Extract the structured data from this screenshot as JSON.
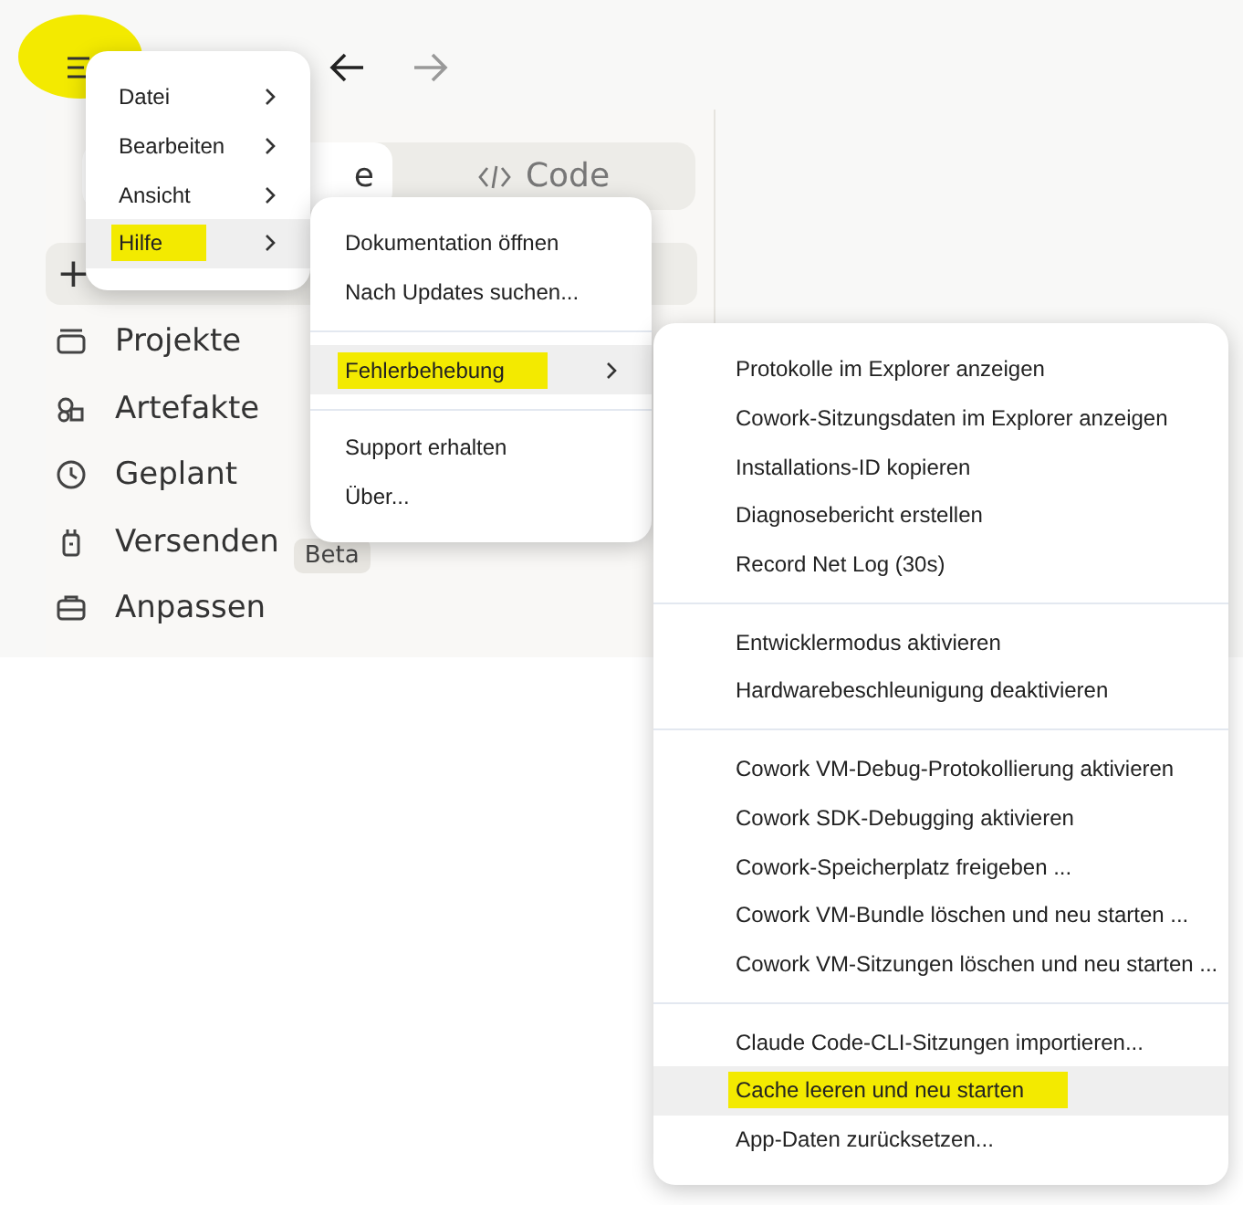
{
  "menu_button": {
    "highlighted": true
  },
  "tabs": [
    {
      "label": "e",
      "selected": true
    },
    {
      "label": "Code",
      "selected": false
    }
  ],
  "new_button": {
    "label": "+"
  },
  "nav": [
    {
      "label": "Projekte",
      "kind": "projects"
    },
    {
      "label": "Artefakte",
      "kind": "artifacts"
    },
    {
      "label": "Geplant",
      "kind": "scheduled"
    },
    {
      "label": "Versenden",
      "kind": "send",
      "badge": "Beta"
    },
    {
      "label": "Anpassen",
      "kind": "customize"
    }
  ],
  "menus": [
    {
      "items": [
        {
          "kind": "item",
          "label": "Datei",
          "submenu": true,
          "selected": false,
          "highlighted": false
        },
        {
          "kind": "item",
          "label": "Bearbeiten",
          "submenu": true,
          "selected": false,
          "highlighted": false
        },
        {
          "kind": "item",
          "label": "Ansicht",
          "submenu": true,
          "selected": false,
          "highlighted": false
        },
        {
          "kind": "item",
          "label": "Hilfe",
          "submenu": true,
          "selected": true,
          "highlighted": true
        }
      ]
    },
    {
      "items": [
        {
          "kind": "item",
          "label": "Dokumentation öffnen",
          "submenu": false,
          "selected": false,
          "highlighted": false
        },
        {
          "kind": "item",
          "label": "Nach Updates suchen...",
          "submenu": false,
          "selected": false,
          "highlighted": false
        },
        {
          "kind": "separator"
        },
        {
          "kind": "item",
          "label": "Fehlerbehebung",
          "submenu": true,
          "selected": true,
          "highlighted": true
        },
        {
          "kind": "separator"
        },
        {
          "kind": "item",
          "label": "Support erhalten",
          "submenu": false,
          "selected": false,
          "highlighted": false
        },
        {
          "kind": "item",
          "label": "Über...",
          "submenu": false,
          "selected": false,
          "highlighted": false
        }
      ]
    },
    {
      "items": [
        {
          "kind": "item",
          "label": "Protokolle im Explorer anzeigen",
          "submenu": false,
          "selected": false,
          "highlighted": false
        },
        {
          "kind": "item",
          "label": "Cowork-Sitzungsdaten im Explorer anzeigen",
          "submenu": false,
          "selected": false,
          "highlighted": false
        },
        {
          "kind": "item",
          "label": "Installations-ID kopieren",
          "submenu": false,
          "selected": false,
          "highlighted": false
        },
        {
          "kind": "item",
          "label": "Diagnosebericht erstellen",
          "submenu": false,
          "selected": false,
          "highlighted": false
        },
        {
          "kind": "item",
          "label": "Record Net Log (30s)",
          "submenu": false,
          "selected": false,
          "highlighted": false
        },
        {
          "kind": "separator"
        },
        {
          "kind": "item",
          "label": "Entwicklermodus aktivieren",
          "submenu": false,
          "selected": false,
          "highlighted": false
        },
        {
          "kind": "item",
          "label": "Hardwarebeschleunigung deaktivieren",
          "submenu": false,
          "selected": false,
          "highlighted": false
        },
        {
          "kind": "separator"
        },
        {
          "kind": "item",
          "label": "Cowork VM-Debug-Protokollierung aktivieren",
          "submenu": false,
          "selected": false,
          "highlighted": false
        },
        {
          "kind": "item",
          "label": "Cowork SDK-Debugging aktivieren",
          "submenu": false,
          "selected": false,
          "highlighted": false
        },
        {
          "kind": "item",
          "label": "Cowork-Speicherplatz freigeben ...",
          "submenu": false,
          "selected": false,
          "highlighted": false
        },
        {
          "kind": "item",
          "label": "Cowork VM-Bundle löschen und neu starten ...",
          "submenu": false,
          "selected": false,
          "highlighted": false
        },
        {
          "kind": "item",
          "label": "Cowork VM-Sitzungen löschen und neu starten ...",
          "submenu": false,
          "selected": false,
          "highlighted": false
        },
        {
          "kind": "separator"
        },
        {
          "kind": "item",
          "label": "Claude Code-CLI-Sitzungen importieren...",
          "submenu": false,
          "selected": false,
          "highlighted": false
        },
        {
          "kind": "item",
          "label": "Cache leeren und neu starten",
          "submenu": false,
          "selected": true,
          "highlighted": true
        },
        {
          "kind": "item",
          "label": "App-Daten zurücksetzen...",
          "submenu": false,
          "selected": false,
          "highlighted": false
        }
      ]
    }
  ]
}
